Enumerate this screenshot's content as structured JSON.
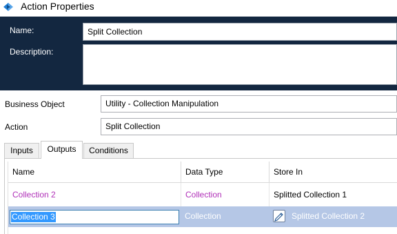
{
  "window": {
    "title": "Action Properties",
    "icon": "action-properties-icon"
  },
  "header": {
    "name_label": "Name:",
    "name_value": "Split Collection",
    "description_label": "Description:",
    "description_value": ""
  },
  "form": {
    "business_object_label": "Business Object",
    "business_object_value": "Utility - Collection Manipulation",
    "action_label": "Action",
    "action_value": "Split Collection"
  },
  "tabs": [
    {
      "label": "Inputs",
      "selected": false
    },
    {
      "label": "Outputs",
      "selected": true
    },
    {
      "label": "Conditions",
      "selected": false
    }
  ],
  "grid": {
    "columns": [
      "Name",
      "Data Type",
      "Store In"
    ],
    "rows": [
      {
        "name": "Collection 2",
        "data_type": "Collection",
        "store_in": "Splitted Collection 1",
        "selected": false
      },
      {
        "name": "Collection 3",
        "data_type": "Collection",
        "store_in": "Splitted Collection 2",
        "selected": true,
        "store_icon": "pencil-icon"
      }
    ]
  },
  "colors": {
    "header_bg": "#132740",
    "output_name_color": "#b030b8",
    "selected_row_bg": "#b5c7e6",
    "text_selection": "#3399ff"
  }
}
